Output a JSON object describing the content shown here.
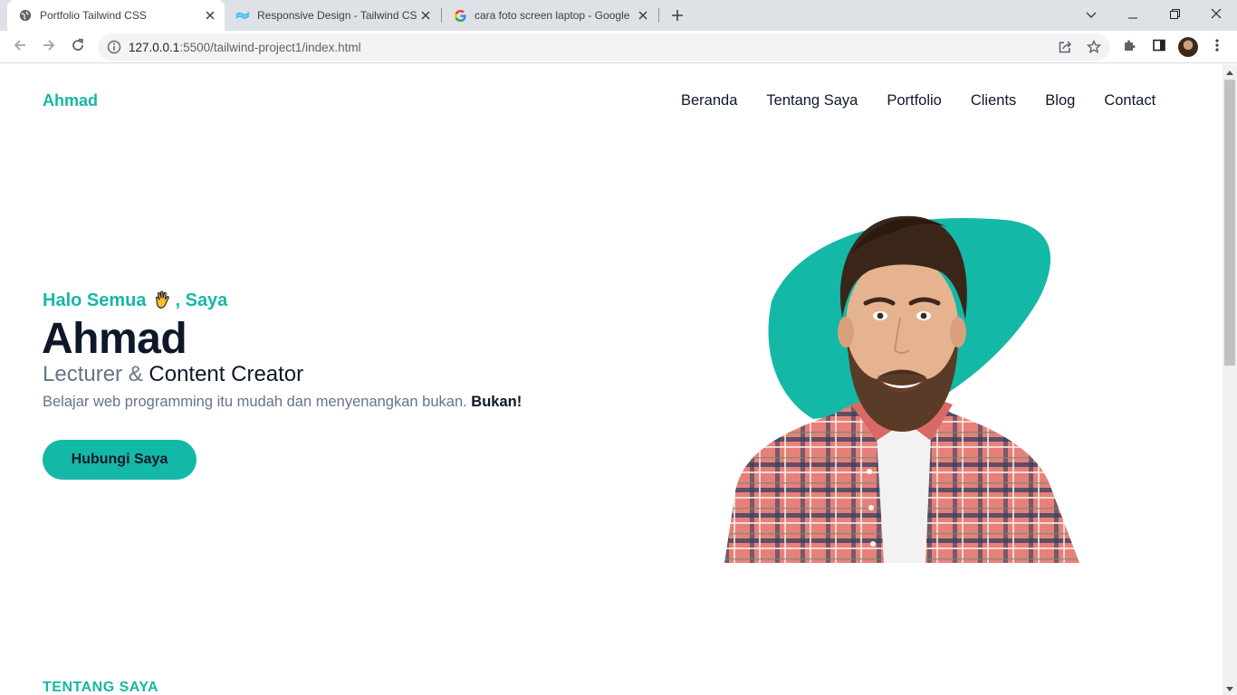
{
  "browser": {
    "tabs": [
      {
        "title": "Portfolio Tailwind CSS",
        "icon": "globe-icon",
        "active": true
      },
      {
        "title": "Responsive Design - Tailwind CSS",
        "icon": "tailwind-icon",
        "active": false
      },
      {
        "title": "cara foto screen laptop - Google",
        "icon": "google-icon",
        "active": false
      }
    ],
    "url_host": "127.0.0.1",
    "url_path": ":5500/tailwind-project1/index.html"
  },
  "page": {
    "brand": "Ahmad",
    "nav": [
      "Beranda",
      "Tentang Saya",
      "Portfolio",
      "Clients",
      "Blog",
      "Contact"
    ],
    "hero": {
      "greet_before": "Halo Semua",
      "greet_after": ", Saya",
      "name": "Ahmad",
      "role_muted": "Lecturer &",
      "role_main": "Content Creator",
      "desc": "Belajar web programming itu mudah dan menyenangkan bukan.",
      "desc_bold": "Bukan!",
      "cta": "Hubungi Saya"
    },
    "section_label": "TENTANG SAYA"
  },
  "colors": {
    "primary": "#14b8a6",
    "dark": "#0f172a",
    "muted": "#64748b"
  }
}
